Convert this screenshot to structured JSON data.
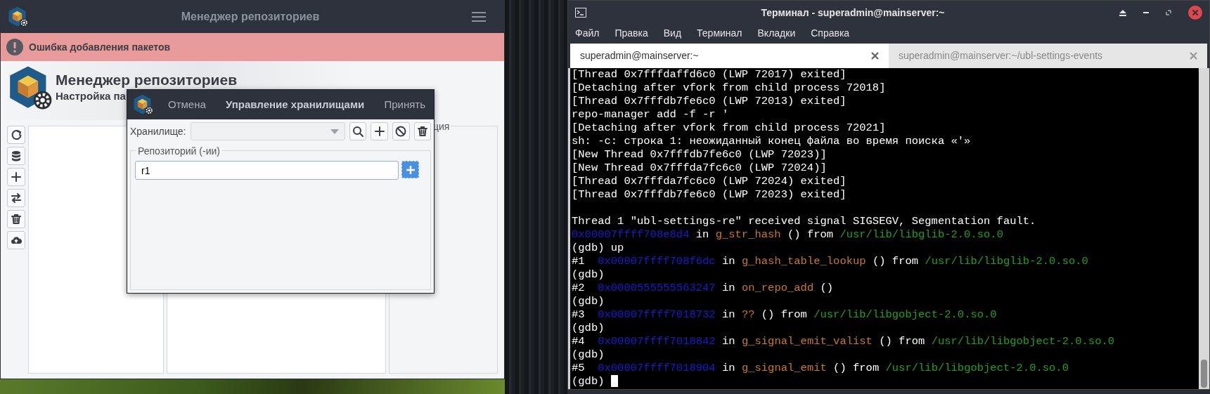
{
  "app_window": {
    "title": "Менеджер репозиториев",
    "error_message": "Ошибка добавления пакетов",
    "header_title": "Менеджер репозиториев",
    "header_subtitle": "Настройка па",
    "side_panel_legend": "ция"
  },
  "dialog": {
    "cancel_button": "Отмена",
    "title": "Управление хранилищами",
    "accept_button": "Принять",
    "storage_label": "Хранилище:",
    "repositories_legend": "Репозиторий (-ии)",
    "repository_input": {
      "value": "r1"
    }
  },
  "terminal": {
    "title": "Терминал - superadmin@mainserver:~",
    "menu": [
      "Файл",
      "Правка",
      "Вид",
      "Терминал",
      "Вкладки",
      "Справка"
    ],
    "tabs": [
      {
        "label": "superadmin@mainserver:~",
        "selected": true
      },
      {
        "label": "superadmin@mainserver:~/ubl-settings-events",
        "selected": false
      }
    ],
    "lines": [
      {
        "kind": "output",
        "segments": [
          {
            "kind": "plain",
            "text": "[Thread 0x7fffdaffd6c0 (LWP 72017) exited]"
          }
        ]
      },
      {
        "kind": "output",
        "segments": [
          {
            "kind": "plain",
            "text": "[Detaching after vfork from child process 72018]"
          }
        ]
      },
      {
        "kind": "output",
        "segments": [
          {
            "kind": "plain",
            "text": "[Thread 0x7fffdb7fe6c0 (LWP 72013) exited]"
          }
        ]
      },
      {
        "kind": "output",
        "segments": [
          {
            "kind": "plain",
            "text": "repo-manager add -f -r '"
          }
        ]
      },
      {
        "kind": "output",
        "segments": [
          {
            "kind": "plain",
            "text": "[Detaching after vfork from child process 72021]"
          }
        ]
      },
      {
        "kind": "output",
        "segments": [
          {
            "kind": "plain",
            "text": "sh: -c: строка 1: неожиданный конец файла во время поиска «'»"
          }
        ]
      },
      {
        "kind": "output",
        "segments": [
          {
            "kind": "plain",
            "text": "[New Thread 0x7fffdb7fe6c0 (LWP 72023)]"
          }
        ]
      },
      {
        "kind": "output",
        "segments": [
          {
            "kind": "plain",
            "text": "[New Thread 0x7fffda7fc6c0 (LWP 72024)]"
          }
        ]
      },
      {
        "kind": "output",
        "segments": [
          {
            "kind": "plain",
            "text": "[Thread 0x7fffda7fc6c0 (LWP 72024) exited]"
          }
        ]
      },
      {
        "kind": "output",
        "segments": [
          {
            "kind": "plain",
            "text": "[Thread 0x7fffdb7fe6c0 (LWP 72023) exited]"
          }
        ]
      },
      {
        "kind": "blank"
      },
      {
        "kind": "output",
        "segments": [
          {
            "kind": "plain",
            "text": "Thread 1 \"ubl-settings-re\" received signal SIGSEGV, Segmentation fault."
          }
        ]
      },
      {
        "kind": "output",
        "segments": [
          {
            "kind": "address",
            "text": "0x00007ffff708e8d4"
          },
          {
            "kind": "plain",
            "text": " in "
          },
          {
            "kind": "function",
            "text": "g_str_hash"
          },
          {
            "kind": "plain",
            "text": " () from "
          },
          {
            "kind": "path",
            "text": "/usr/lib/libglib-2.0.so.0"
          }
        ]
      },
      {
        "kind": "output",
        "segments": [
          {
            "kind": "plain",
            "text": "(gdb) up"
          }
        ]
      },
      {
        "kind": "output",
        "segments": [
          {
            "kind": "plain",
            "text": "#1  "
          },
          {
            "kind": "address",
            "text": "0x00007ffff708f6dc"
          },
          {
            "kind": "plain",
            "text": " in "
          },
          {
            "kind": "function",
            "text": "g_hash_table_lookup"
          },
          {
            "kind": "plain",
            "text": " () from "
          },
          {
            "kind": "path",
            "text": "/usr/lib/libglib-2.0.so.0"
          }
        ]
      },
      {
        "kind": "output",
        "segments": [
          {
            "kind": "plain",
            "text": "(gdb)"
          }
        ]
      },
      {
        "kind": "output",
        "segments": [
          {
            "kind": "plain",
            "text": "#2  "
          },
          {
            "kind": "address",
            "text": "0x0000555555563247"
          },
          {
            "kind": "plain",
            "text": " in "
          },
          {
            "kind": "function",
            "text": "on_repo_add"
          },
          {
            "kind": "plain",
            "text": " ()"
          }
        ]
      },
      {
        "kind": "output",
        "segments": [
          {
            "kind": "plain",
            "text": "(gdb)"
          }
        ]
      },
      {
        "kind": "output",
        "segments": [
          {
            "kind": "plain",
            "text": "#3  "
          },
          {
            "kind": "address",
            "text": "0x00007ffff7018732"
          },
          {
            "kind": "plain",
            "text": " in "
          },
          {
            "kind": "function",
            "text": "??"
          },
          {
            "kind": "plain",
            "text": " () from "
          },
          {
            "kind": "path",
            "text": "/usr/lib/libgobject-2.0.so.0"
          }
        ]
      },
      {
        "kind": "output",
        "segments": [
          {
            "kind": "plain",
            "text": "(gdb)"
          }
        ]
      },
      {
        "kind": "output",
        "segments": [
          {
            "kind": "plain",
            "text": "#4  "
          },
          {
            "kind": "address",
            "text": "0x00007ffff7018842"
          },
          {
            "kind": "plain",
            "text": " in "
          },
          {
            "kind": "function",
            "text": "g_signal_emit_valist"
          },
          {
            "kind": "plain",
            "text": " () from "
          },
          {
            "kind": "path",
            "text": "/usr/lib/libgobject-2.0.so.0"
          }
        ]
      },
      {
        "kind": "output",
        "segments": [
          {
            "kind": "plain",
            "text": "(gdb)"
          }
        ]
      },
      {
        "kind": "output",
        "segments": [
          {
            "kind": "plain",
            "text": "#5  "
          },
          {
            "kind": "address",
            "text": "0x00007ffff7018904"
          },
          {
            "kind": "plain",
            "text": " in "
          },
          {
            "kind": "function",
            "text": "g_signal_emit"
          },
          {
            "kind": "plain",
            "text": " () from "
          },
          {
            "kind": "path",
            "text": "/usr/lib/libgobject-2.0.so.0"
          }
        ]
      },
      {
        "kind": "prompt",
        "text": "(gdb)",
        "cursor": true
      }
    ]
  }
}
